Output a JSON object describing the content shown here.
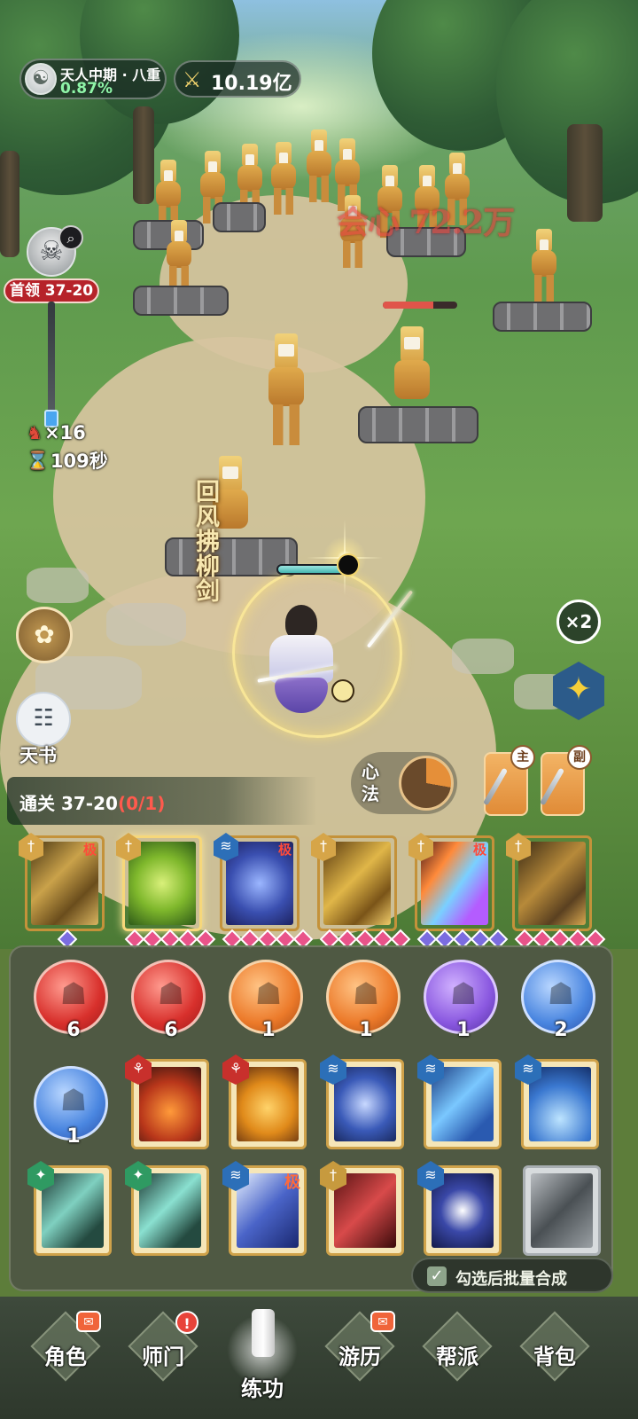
{
  "hud": {
    "realm_name": "天人中期 · 八重",
    "realm_progress": "0.87%",
    "power_value": "10.19亿",
    "boss_stage": "首领 37-20",
    "kills": "×16",
    "timer": "109秒",
    "tianshu_label": "天书",
    "speed_label": "×2",
    "xinfa_label": "心法",
    "weapon_main_tag": "主",
    "weapon_sub_tag": "副"
  },
  "battle": {
    "damage_text": "会心 72.2万",
    "skill_cast_name": "回风拂柳剑",
    "enemy_hp_fraction": 0.68,
    "hero_hp_fraction": 0.82
  },
  "stage_clear": {
    "label": "通关 37-20",
    "progress": "(0/1)"
  },
  "equipped_skills": [
    {
      "type": "sword",
      "grade": "极",
      "gems": 1
    },
    {
      "type": "sword",
      "grade": "",
      "gems": 5
    },
    {
      "type": "wave",
      "grade": "极",
      "gems": 5
    },
    {
      "type": "sword",
      "grade": "",
      "gems": 5
    },
    {
      "type": "sword",
      "grade": "极",
      "gems": 5
    },
    {
      "type": "sword",
      "grade": "",
      "gems": 5
    }
  ],
  "inventory": {
    "orbs": [
      {
        "color": "red",
        "count": "6"
      },
      {
        "color": "red",
        "count": "6"
      },
      {
        "color": "orange",
        "count": "1"
      },
      {
        "color": "orange",
        "count": "1"
      },
      {
        "color": "purple",
        "count": "1"
      },
      {
        "color": "blue",
        "count": "2"
      },
      {
        "color": "blue",
        "count": "1"
      }
    ],
    "cards": [
      {
        "badge": "red",
        "grade": ""
      },
      {
        "badge": "red",
        "grade": ""
      },
      {
        "badge": "blue",
        "grade": ""
      },
      {
        "badge": "blue",
        "grade": ""
      },
      {
        "badge": "blue",
        "grade": ""
      },
      {
        "badge": "green",
        "grade": ""
      },
      {
        "badge": "green",
        "grade": ""
      },
      {
        "badge": "blue",
        "grade": "极"
      },
      {
        "badge": "gold",
        "grade": ""
      },
      {
        "badge": "blue",
        "grade": ""
      },
      {
        "badge": "none",
        "grade": ""
      }
    ],
    "batch_label": "勾选后批量合成",
    "batch_checked": true
  },
  "nav": {
    "items": [
      {
        "label": "角色",
        "alert": "envelope"
      },
      {
        "label": "师门",
        "alert": "!"
      },
      {
        "label": "练功",
        "alert": "",
        "active": true
      },
      {
        "label": "游历",
        "alert": "envelope"
      },
      {
        "label": "帮派",
        "alert": ""
      },
      {
        "label": "背包",
        "alert": ""
      }
    ]
  },
  "colors": {
    "accent_gold": "#c4923a",
    "boss_red": "#b6232a",
    "progress_green": "#8ff5a8",
    "damage_red": "#e0443e"
  }
}
